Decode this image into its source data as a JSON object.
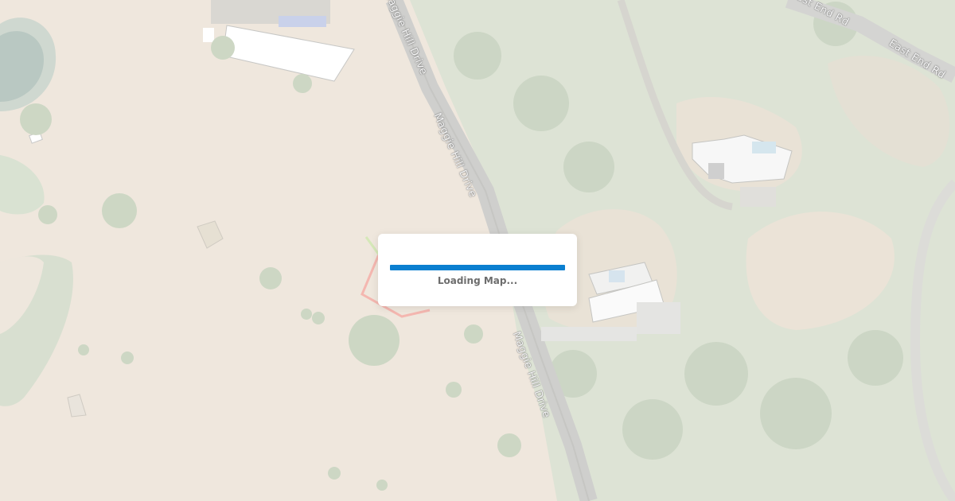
{
  "map": {
    "imagery": "satellite",
    "roads": [
      {
        "id": "maggie-1",
        "label": "Maggie Hill Drive"
      },
      {
        "id": "maggie-2",
        "label": "Maggie Hill Drive"
      },
      {
        "id": "maggie-3",
        "label": "Maggie Hill Drive"
      },
      {
        "id": "east-end-1",
        "label": "East End Rd"
      },
      {
        "id": "east-end-2",
        "label": "East End Rd"
      }
    ]
  },
  "loading": {
    "text": "Loading Map...",
    "progress": 1.0,
    "bar_color": "#0b7fd0"
  }
}
